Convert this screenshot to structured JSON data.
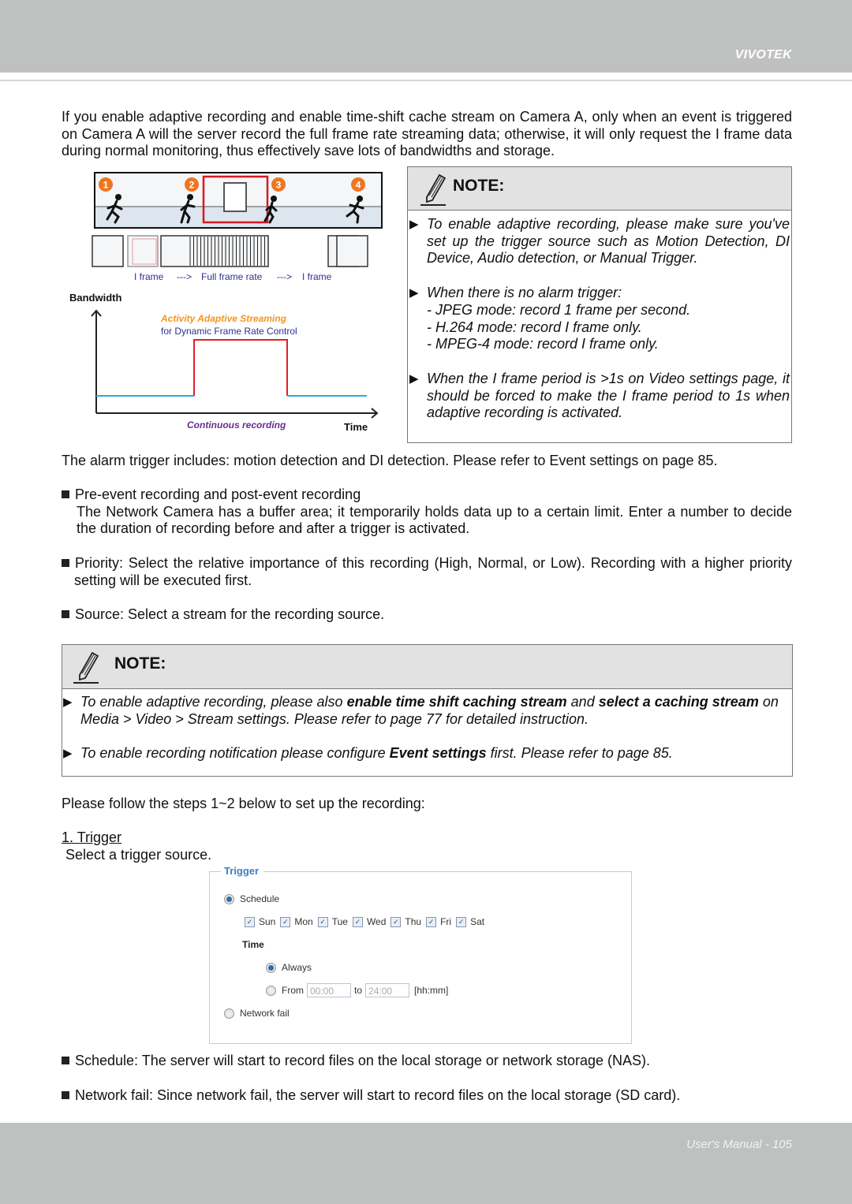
{
  "header": {
    "brand": "VIVOTEK"
  },
  "intro": "If you enable adaptive recording and enable time-shift cache stream on Camera A, only when an event is triggered on Camera A will the server record the full frame rate streaming data; otherwise, it will only request the I frame data during normal monitoring, thus effectively save lots of bandwidths and storage.",
  "figure": {
    "steps": [
      "1",
      "2",
      "3",
      "4"
    ],
    "frame_caption": {
      "left": "I frame",
      "arrow1": "--->",
      "middle": "Full frame rate",
      "arrow2": "--->",
      "right": "I frame"
    },
    "y_label": "Bandwidth",
    "x_label": "Time",
    "title_orange": "Activity Adaptive Streaming",
    "title_blue": "for Dynamic Frame Rate Control",
    "bottom_label": "Continuous recording",
    "colors": {
      "orange": "#f7941d",
      "blue": "#2e3192",
      "red": "#e31e24",
      "cyan": "#29a9e0",
      "purple": "#662d91"
    }
  },
  "note1": {
    "title": "NOTE:",
    "items": [
      "To enable adaptive recording, please make sure you've set up the trigger source such as Motion Detection, DI Device, Audio detection, or Manual Trigger.",
      "When there is no alarm trigger:",
      "When the I frame period is >1s on Video settings page, it should be forced to make the I frame period to 1s when adaptive recording is activated."
    ],
    "sub_items": [
      "- JPEG mode: record 1 frame per second.",
      "- H.264 mode: record I frame only.",
      "- MPEG-4 mode: record I frame only."
    ]
  },
  "alarm_text": "The alarm trigger includes: motion detection and DI detection. Please refer to Event settings on page 85.",
  "bullets": {
    "pre_event_title": "Pre-event recording and post-event recording",
    "pre_event_body": "The Network Camera has a buffer area; it temporarily holds data up to a certain limit. Enter a number to decide the duration of recording before and after a trigger is activated.",
    "priority": "Priority: Select the relative importance of this recording (High, Normal, or Low). Recording with a higher priority setting will be executed first.",
    "source": "Source: Select a stream for the recording source."
  },
  "note2": {
    "title": "NOTE:",
    "item1": {
      "t1": "To enable adaptive recording, please also ",
      "b1": "enable time shift caching stream",
      "t2": " and ",
      "b2": "select a caching stream",
      "t3": " on Media > Video > Stream settings. Please refer to page 77 for detailed instruction."
    },
    "item2": {
      "t1": "To enable recording notification please configure ",
      "b1": "Event settings",
      "t2": " first. Please refer to page 85."
    }
  },
  "steps_intro": "Please follow the steps 1~2 below to set up the recording:",
  "step1": {
    "title": "1. Trigger",
    "desc": "Select a trigger source."
  },
  "trigger_panel": {
    "legend": "Trigger",
    "schedule_label": "Schedule",
    "schedule_selected": true,
    "days": [
      {
        "label": "Sun",
        "checked": true
      },
      {
        "label": "Mon",
        "checked": true
      },
      {
        "label": "Tue",
        "checked": true
      },
      {
        "label": "Wed",
        "checked": true
      },
      {
        "label": "Thu",
        "checked": true
      },
      {
        "label": "Fri",
        "checked": true
      },
      {
        "label": "Sat",
        "checked": true
      }
    ],
    "time_label": "Time",
    "always_label": "Always",
    "always_selected": true,
    "from_label": "From",
    "from_value": "00:00",
    "to_label": "to",
    "to_value": "24:00",
    "format_hint": "[hh:mm]",
    "network_fail_label": "Network fail",
    "network_fail_selected": false
  },
  "schedule_text": "Schedule: The server will start to record files on the local storage or network storage (NAS).",
  "network_fail_text": "Network fail: Since network fail, the server will start to record files on the local storage (SD card).",
  "footer": {
    "page_label": "User's Manual - 105"
  }
}
